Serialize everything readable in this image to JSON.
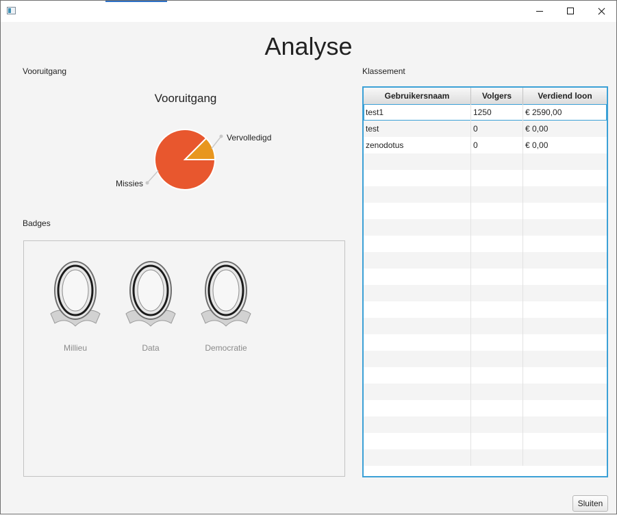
{
  "window": {
    "title": ""
  },
  "page": {
    "title": "Analyse"
  },
  "progress": {
    "section_label": "Vooruitgang",
    "chart_data": {
      "type": "pie",
      "title": "Vooruitgang",
      "labels": [
        "Vervolledigd",
        "Missies"
      ],
      "values": [
        1,
        7
      ],
      "colors": [
        "#e8961e",
        "#e8572e"
      ]
    }
  },
  "badges": {
    "section_label": "Badges",
    "items": [
      {
        "label": "Millieu",
        "icon": "badge-frame-icon"
      },
      {
        "label": "Data",
        "icon": "badge-frame-icon"
      },
      {
        "label": "Democratie",
        "icon": "badge-frame-icon"
      }
    ]
  },
  "ranking": {
    "section_label": "Klassement",
    "columns": [
      "Gebruikersnaam",
      "Volgers",
      "Verdiend loon"
    ],
    "rows": [
      [
        "test1",
        "1250",
        "€ 2590,00"
      ],
      [
        "test",
        "0",
        "€ 0,00"
      ],
      [
        "zenodotus",
        "0",
        "€ 0,00"
      ]
    ],
    "selected_row": 0,
    "accent_color": "#3ba0d6"
  },
  "footer": {
    "close_label": "Sluiten"
  }
}
